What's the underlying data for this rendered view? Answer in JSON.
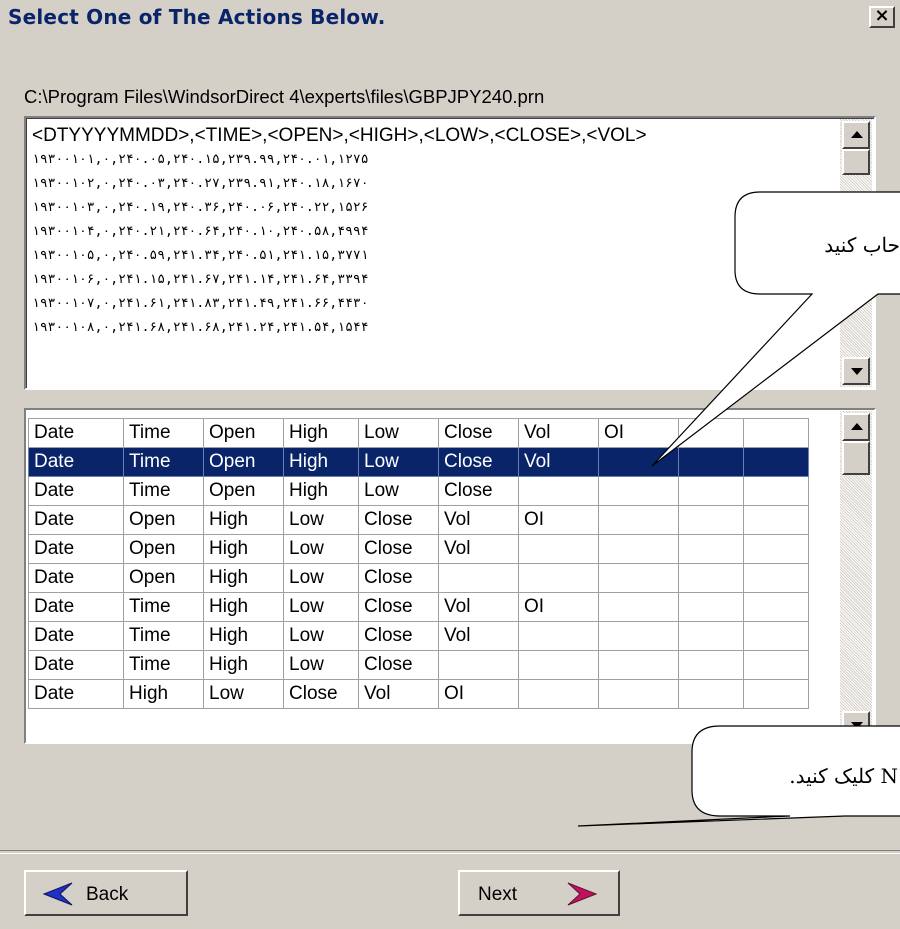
{
  "window": {
    "title": "Select One of The Actions Below.",
    "close_label": "×"
  },
  "file_path": "C:\\Program Files\\WindsorDirect 4\\experts\\files\\GBPJPY240.prn",
  "preview": {
    "header_line": "<DTYYYYMMDD>,<TIME>,<OPEN>,<HIGH>,<LOW>,<CLOSE>,<VOL>",
    "data_lines": [
      "۱۹۳۰۰۱۰۱,۰,۲۴۰.۰۵,۲۴۰.۱۵,۲۳۹.۹۹,۲۴۰.۰۱,۱۲۷۵",
      "۱۹۳۰۰۱۰۲,۰,۲۴۰.۰۳,۲۴۰.۲۷,۲۳۹.۹۱,۲۴۰.۱۸,۱۶۷۰",
      "۱۹۳۰۰۱۰۳,۰,۲۴۰.۱۹,۲۴۰.۳۶,۲۴۰.۰۶,۲۴۰.۲۲,۱۵۲۶",
      "۱۹۳۰۰۱۰۴,۰,۲۴۰.۲۱,۲۴۰.۶۴,۲۴۰.۱۰,۲۴۰.۵۸,۴۹۹۴",
      "۱۹۳۰۰۱۰۵,۰,۲۴۰.۵۹,۲۴۱.۳۴,۲۴۰.۵۱,۲۴۱.۱۵,۳۷۷۱",
      "۱۹۳۰۰۱۰۶,۰,۲۴۱.۱۵,۲۴۱.۶۷,۲۴۱.۱۴,۲۴۱.۶۴,۳۳۹۴",
      "۱۹۳۰۰۱۰۷,۰,۲۴۱.۶۱,۲۴۱.۸۳,۲۴۱.۴۹,۲۴۱.۶۶,۴۴۳۰",
      "۱۹۳۰۰۱۰۸,۰,۲۴۱.۶۸,۲۴۱.۶۸,۲۴۱.۲۴,۲۴۱.۵۴,۱۵۴۴"
    ]
  },
  "grid": {
    "rows": [
      [
        "Date",
        "Time",
        "Open",
        "High",
        "Low",
        "Close",
        "Vol",
        "OI",
        "",
        ""
      ],
      [
        "Date",
        "Time",
        "Open",
        "High",
        "Low",
        "Close",
        "Vol",
        "",
        "",
        ""
      ],
      [
        "Date",
        "Time",
        "Open",
        "High",
        "Low",
        "Close",
        "",
        "",
        "",
        ""
      ],
      [
        "Date",
        "Open",
        "High",
        "Low",
        "Close",
        "Vol",
        "OI",
        "",
        "",
        ""
      ],
      [
        "Date",
        "Open",
        "High",
        "Low",
        "Close",
        "Vol",
        "",
        "",
        "",
        ""
      ],
      [
        "Date",
        "Open",
        "High",
        "Low",
        "Close",
        "",
        "",
        "",
        "",
        ""
      ],
      [
        "Date",
        "Time",
        "High",
        "Low",
        "Close",
        "Vol",
        "OI",
        "",
        "",
        ""
      ],
      [
        "Date",
        "Time",
        "High",
        "Low",
        "Close",
        "Vol",
        "",
        "",
        "",
        ""
      ],
      [
        "Date",
        "Time",
        "High",
        "Low",
        "Close",
        "",
        "",
        "",
        "",
        ""
      ],
      [
        "Date",
        "High",
        "Low",
        "Close",
        "Vol",
        "OI",
        "",
        "",
        "",
        ""
      ]
    ],
    "selected_row": 1
  },
  "callouts": {
    "select_text": "حاب کنید",
    "next_text": "N کلیک کنید."
  },
  "buttons": {
    "back_label": "Back",
    "next_label": "Next"
  },
  "colors": {
    "title": "#0a246a",
    "selection": "#0a246a",
    "back_arrow": "#2030c0",
    "next_arrow": "#c01060"
  }
}
